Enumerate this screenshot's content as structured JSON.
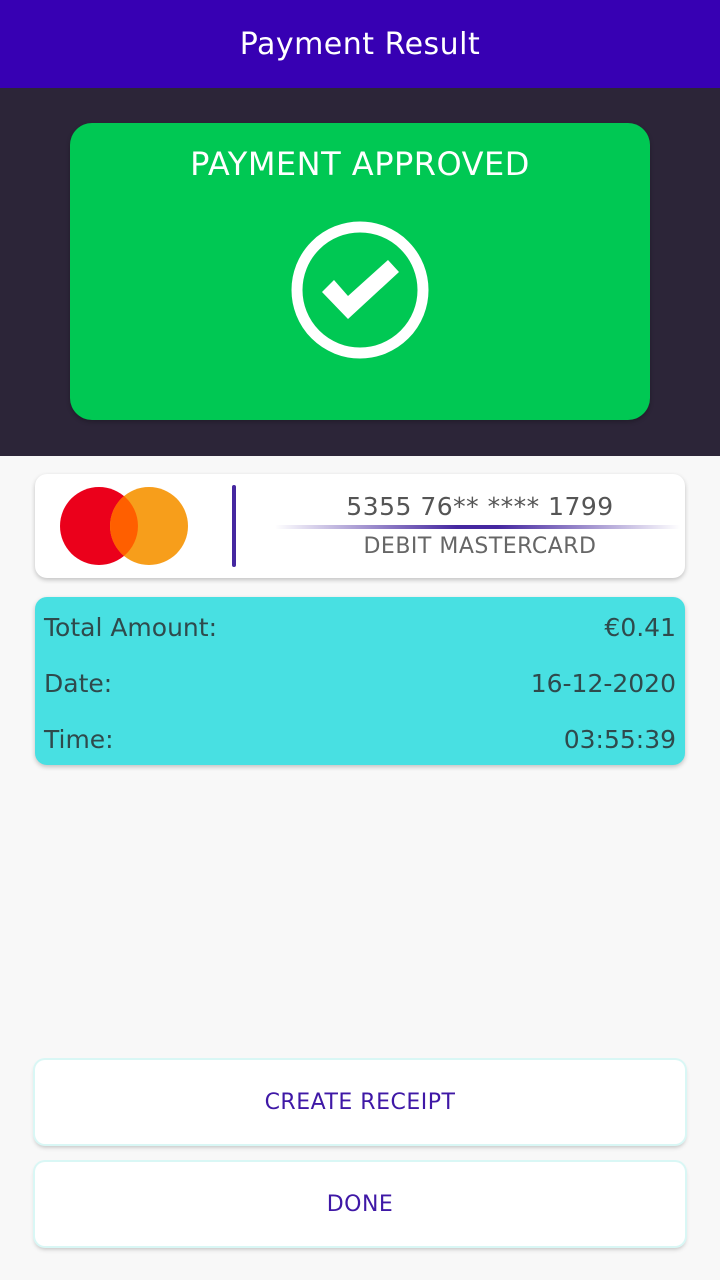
{
  "appbar": {
    "title": "Payment Result"
  },
  "status": {
    "title": "PAYMENT APPROVED",
    "icon": "check-circle-icon",
    "color": "#00c853"
  },
  "card": {
    "brand_icon": "mastercard-logo",
    "number": "5355 76** **** 1799",
    "type": "DEBIT MASTERCARD"
  },
  "details": [
    {
      "label": "Total Amount:",
      "value": "€0.41"
    },
    {
      "label": "Date:",
      "value": "16-12-2020"
    },
    {
      "label": "Time:",
      "value": "03:55:39"
    }
  ],
  "actions": {
    "create_receipt": "CREATE RECEIPT",
    "done": "DONE"
  },
  "colors": {
    "appbar": "#3700b3",
    "hero_bg": "#2c2538",
    "details_bg": "#48e0e2",
    "accent_text": "#3f18a6"
  }
}
